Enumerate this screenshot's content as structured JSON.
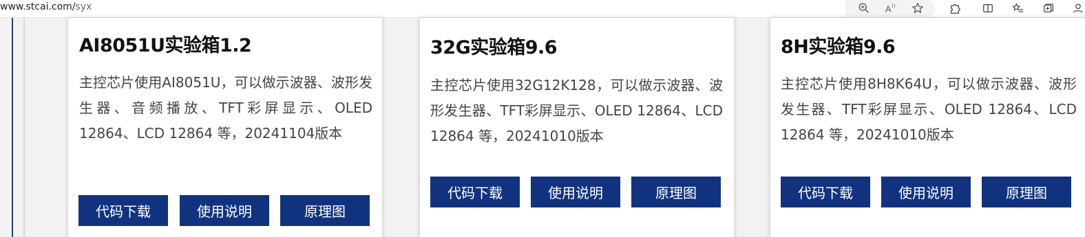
{
  "browser": {
    "url_host": "www.stcai.com/",
    "url_path": "syx",
    "icons": [
      "zoom-icon",
      "read-aloud-icon",
      "favorite-star-icon",
      "extensions-icon",
      "split-screen-icon",
      "favorites-list-icon",
      "collections-icon",
      "profile-icon"
    ]
  },
  "cards": [
    {
      "title": "AI8051U实验箱1.2",
      "description": "主控芯片使用AI8051U，可以做示波器、波形发生器、音频播放、TFT彩屏显示、OLED 12864、LCD 12864 等，20241104版本",
      "buttons": [
        "代码下载",
        "使用说明",
        "原理图"
      ]
    },
    {
      "title": "32G实验箱9.6",
      "description": "主控芯片使用32G12K128，可以做示波器、波形发生器、TFT彩屏显示、OLED 12864、LCD 12864 等，20241010版本",
      "buttons": [
        "代码下载",
        "使用说明",
        "原理图"
      ]
    },
    {
      "title": "8H实验箱9.6",
      "description": "主控芯片使用8H8K64U，可以做示波器、波形发生器、TFT彩屏显示、OLED 12864、LCD 12864 等，20241010版本",
      "buttons": [
        "代码下载",
        "使用说明",
        "原理图"
      ]
    }
  ],
  "colors": {
    "button_bg": "#11337f",
    "button_text": "#ffffff",
    "title": "#111111",
    "body_text": "#444444"
  }
}
